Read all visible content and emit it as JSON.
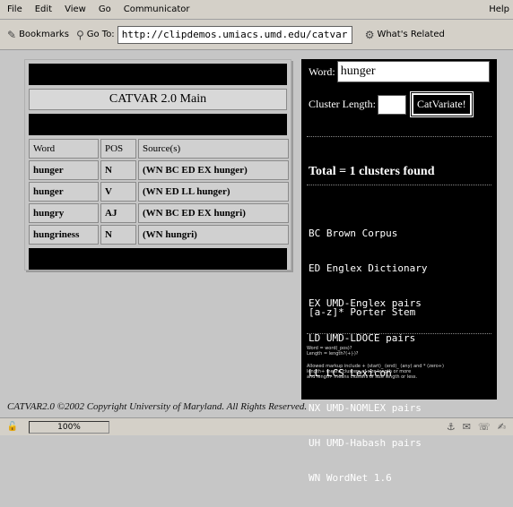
{
  "menubar": {
    "items": [
      "File",
      "Edit",
      "View",
      "Go",
      "Communicator"
    ],
    "help": "Help"
  },
  "toolbar": {
    "bookmarks_label": "Bookmarks",
    "goto_label": "Go To:",
    "url": "http://clipdemos.umiacs.umd.edu/catvar/",
    "related_label": "What's Related"
  },
  "main": {
    "title": "CATVAR 2.0 Main",
    "columns": [
      "Word",
      "POS",
      "Source(s)"
    ],
    "rows": [
      {
        "word": "hunger",
        "pos": "N",
        "source": "(WN BC ED EX hunger)"
      },
      {
        "word": "hunger",
        "pos": "V",
        "source": "(WN ED LL hunger)"
      },
      {
        "word": "hungry",
        "pos": "AJ",
        "source": "(WN BC ED EX hungri)"
      },
      {
        "word": "hungriness",
        "pos": "N",
        "source": "(WN hungri)"
      }
    ]
  },
  "search": {
    "word_label": "Word:",
    "word_value": "hunger",
    "cluster_label": "Cluster Length:",
    "cluster_value": "",
    "button_label": "CatVariate!",
    "total": "Total = 1 clusters found",
    "legend": [
      "BC Brown Corpus",
      "ED Englex Dictionary",
      "EX UMD-Englex pairs",
      "LD UMD-LDOCE pairs",
      "LL LCS Lexicon",
      "NX UMD-NOMLEX pairs",
      "UH UMD-Habash pairs",
      "WN WordNet 1.6"
    ],
    "stem_note": "[a-z]* Porter Stem",
    "tiny_syntax": "Word = word(_pos)?\nLength = length?(+|-)?",
    "tiny_help": "Allowed markup include + (start)_ (end)_ (any) and * (zero+)\nlength+ means clusters of size length or more\nand length- means clusters of size length or less."
  },
  "footer": {
    "copyright": "CATVAR2.0 ©2002 Copyright University of Maryland. All Rights Reserved."
  },
  "status": {
    "progress": "100%"
  }
}
